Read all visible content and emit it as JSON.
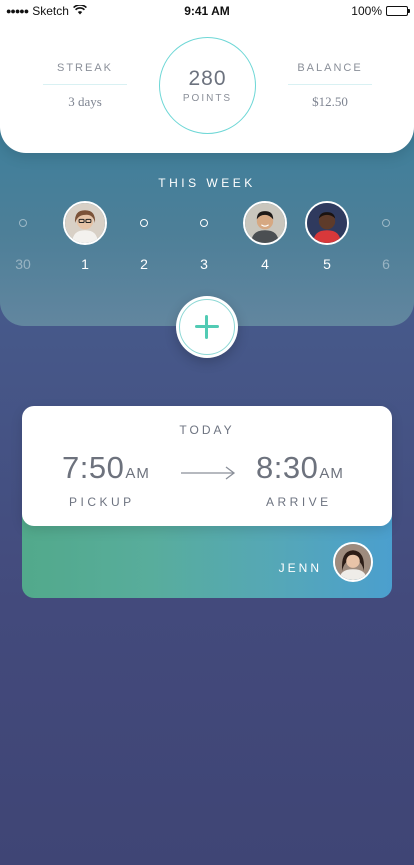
{
  "status_bar": {
    "carrier": "Sketch",
    "time": "9:41 AM",
    "battery": "100%",
    "battery_level": 1.0,
    "signal_dots": "●●●●●"
  },
  "summary": {
    "streak_label": "STREAK",
    "streak_value": "3 days",
    "points_value": "280",
    "points_label": "POINTS",
    "balance_label": "BALANCE",
    "balance_value": "$12.50"
  },
  "week": {
    "title": "THIS WEEK",
    "days": [
      {
        "num": "30",
        "has_ride": false,
        "in_week": false
      },
      {
        "num": "1",
        "has_ride": true,
        "in_week": true
      },
      {
        "num": "2",
        "has_ride": false,
        "in_week": true
      },
      {
        "num": "3",
        "has_ride": false,
        "in_week": true
      },
      {
        "num": "4",
        "has_ride": true,
        "in_week": true
      },
      {
        "num": "5",
        "has_ride": true,
        "in_week": true
      },
      {
        "num": "6",
        "has_ride": false,
        "in_week": false
      }
    ]
  },
  "add_button": {
    "icon": "plus-icon"
  },
  "ride": {
    "day_label": "TODAY",
    "pickup_time": "7:50",
    "pickup_ampm": "AM",
    "pickup_label": "PICKUP",
    "arrive_time": "8:30",
    "arrive_ampm": "AM",
    "arrive_label": "ARRIVE",
    "driver_name": "JENN"
  },
  "colors": {
    "accent_teal": "#6ed7d6",
    "plus_green": "#52cbb4",
    "text_gray": "#6d7380",
    "panel_top": "#3d7f9b",
    "background": "#434a7c"
  }
}
